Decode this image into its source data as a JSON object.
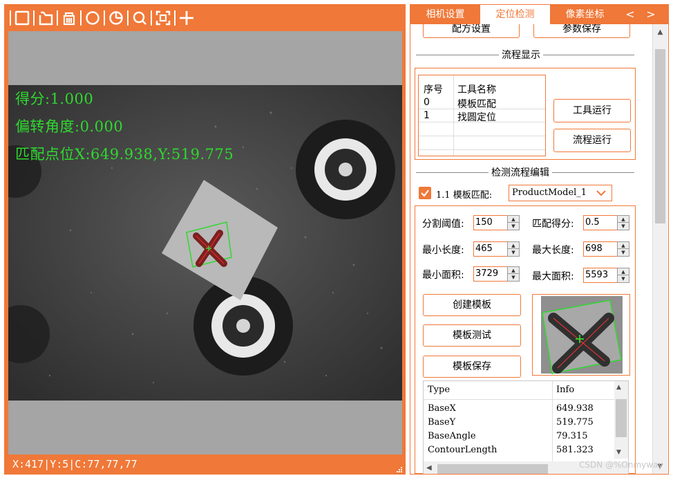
{
  "viewer": {
    "toolbar_icons": [
      "rectangle-icon",
      "rotated-rectangle-icon",
      "ring-icon",
      "circle-icon",
      "pie-icon",
      "zoom-icon",
      "fit-screen-icon",
      "crosshair-icon"
    ],
    "overlay": {
      "score": "得分:1.000",
      "angle": "偏转角度:0.000",
      "position": "匹配点位X:649.938,Y:519.775"
    },
    "status": "X:417|Y:5|C:77,77,77"
  },
  "tabs": {
    "camera": "相机设置",
    "locate": "定位检测",
    "pixel": "像素坐标",
    "prev": "<",
    "next": ">"
  },
  "top_buttons": {
    "recipe": "配方设置",
    "save_params": "参数保存"
  },
  "flow_display": {
    "title": "流程显示",
    "headers": [
      "序号",
      "工具名称"
    ],
    "rows": [
      {
        "index": "0",
        "name": "模板匹配"
      },
      {
        "index": "1",
        "name": "找圆定位"
      }
    ],
    "tool_run": "工具运行",
    "flow_run": "流程运行"
  },
  "flow_edit": {
    "title": "检测流程编辑",
    "step_label": "1.1 模板匹配:",
    "model_select": "ProductModel_1",
    "fields": {
      "threshold_label": "分割阈值:",
      "threshold_value": "150",
      "score_label": "匹配得分:",
      "score_value": "0.5",
      "min_len_label": "最小长度:",
      "min_len_value": "465",
      "max_len_label": "最大长度:",
      "max_len_value": "698",
      "min_area_label": "最小面积:",
      "min_area_value": "3729",
      "max_area_label": "最大面积:",
      "max_area_value": "5593"
    },
    "create_model": "创建模板",
    "test_model": "模板测试",
    "save_model": "模板保存"
  },
  "info_grid": {
    "headers": [
      "Type",
      "Info"
    ],
    "rows": [
      {
        "type": "BaseX",
        "info": "649.938"
      },
      {
        "type": "BaseY",
        "info": "519.775"
      },
      {
        "type": "BaseAngle",
        "info": "79.315"
      },
      {
        "type": "ContourLength",
        "info": "581.323"
      }
    ]
  },
  "watermark": "CSDN @%Onmyway",
  "colors": {
    "accent": "#f07838",
    "overlay_green": "#2fd92f",
    "contour_red": "#e03030"
  }
}
